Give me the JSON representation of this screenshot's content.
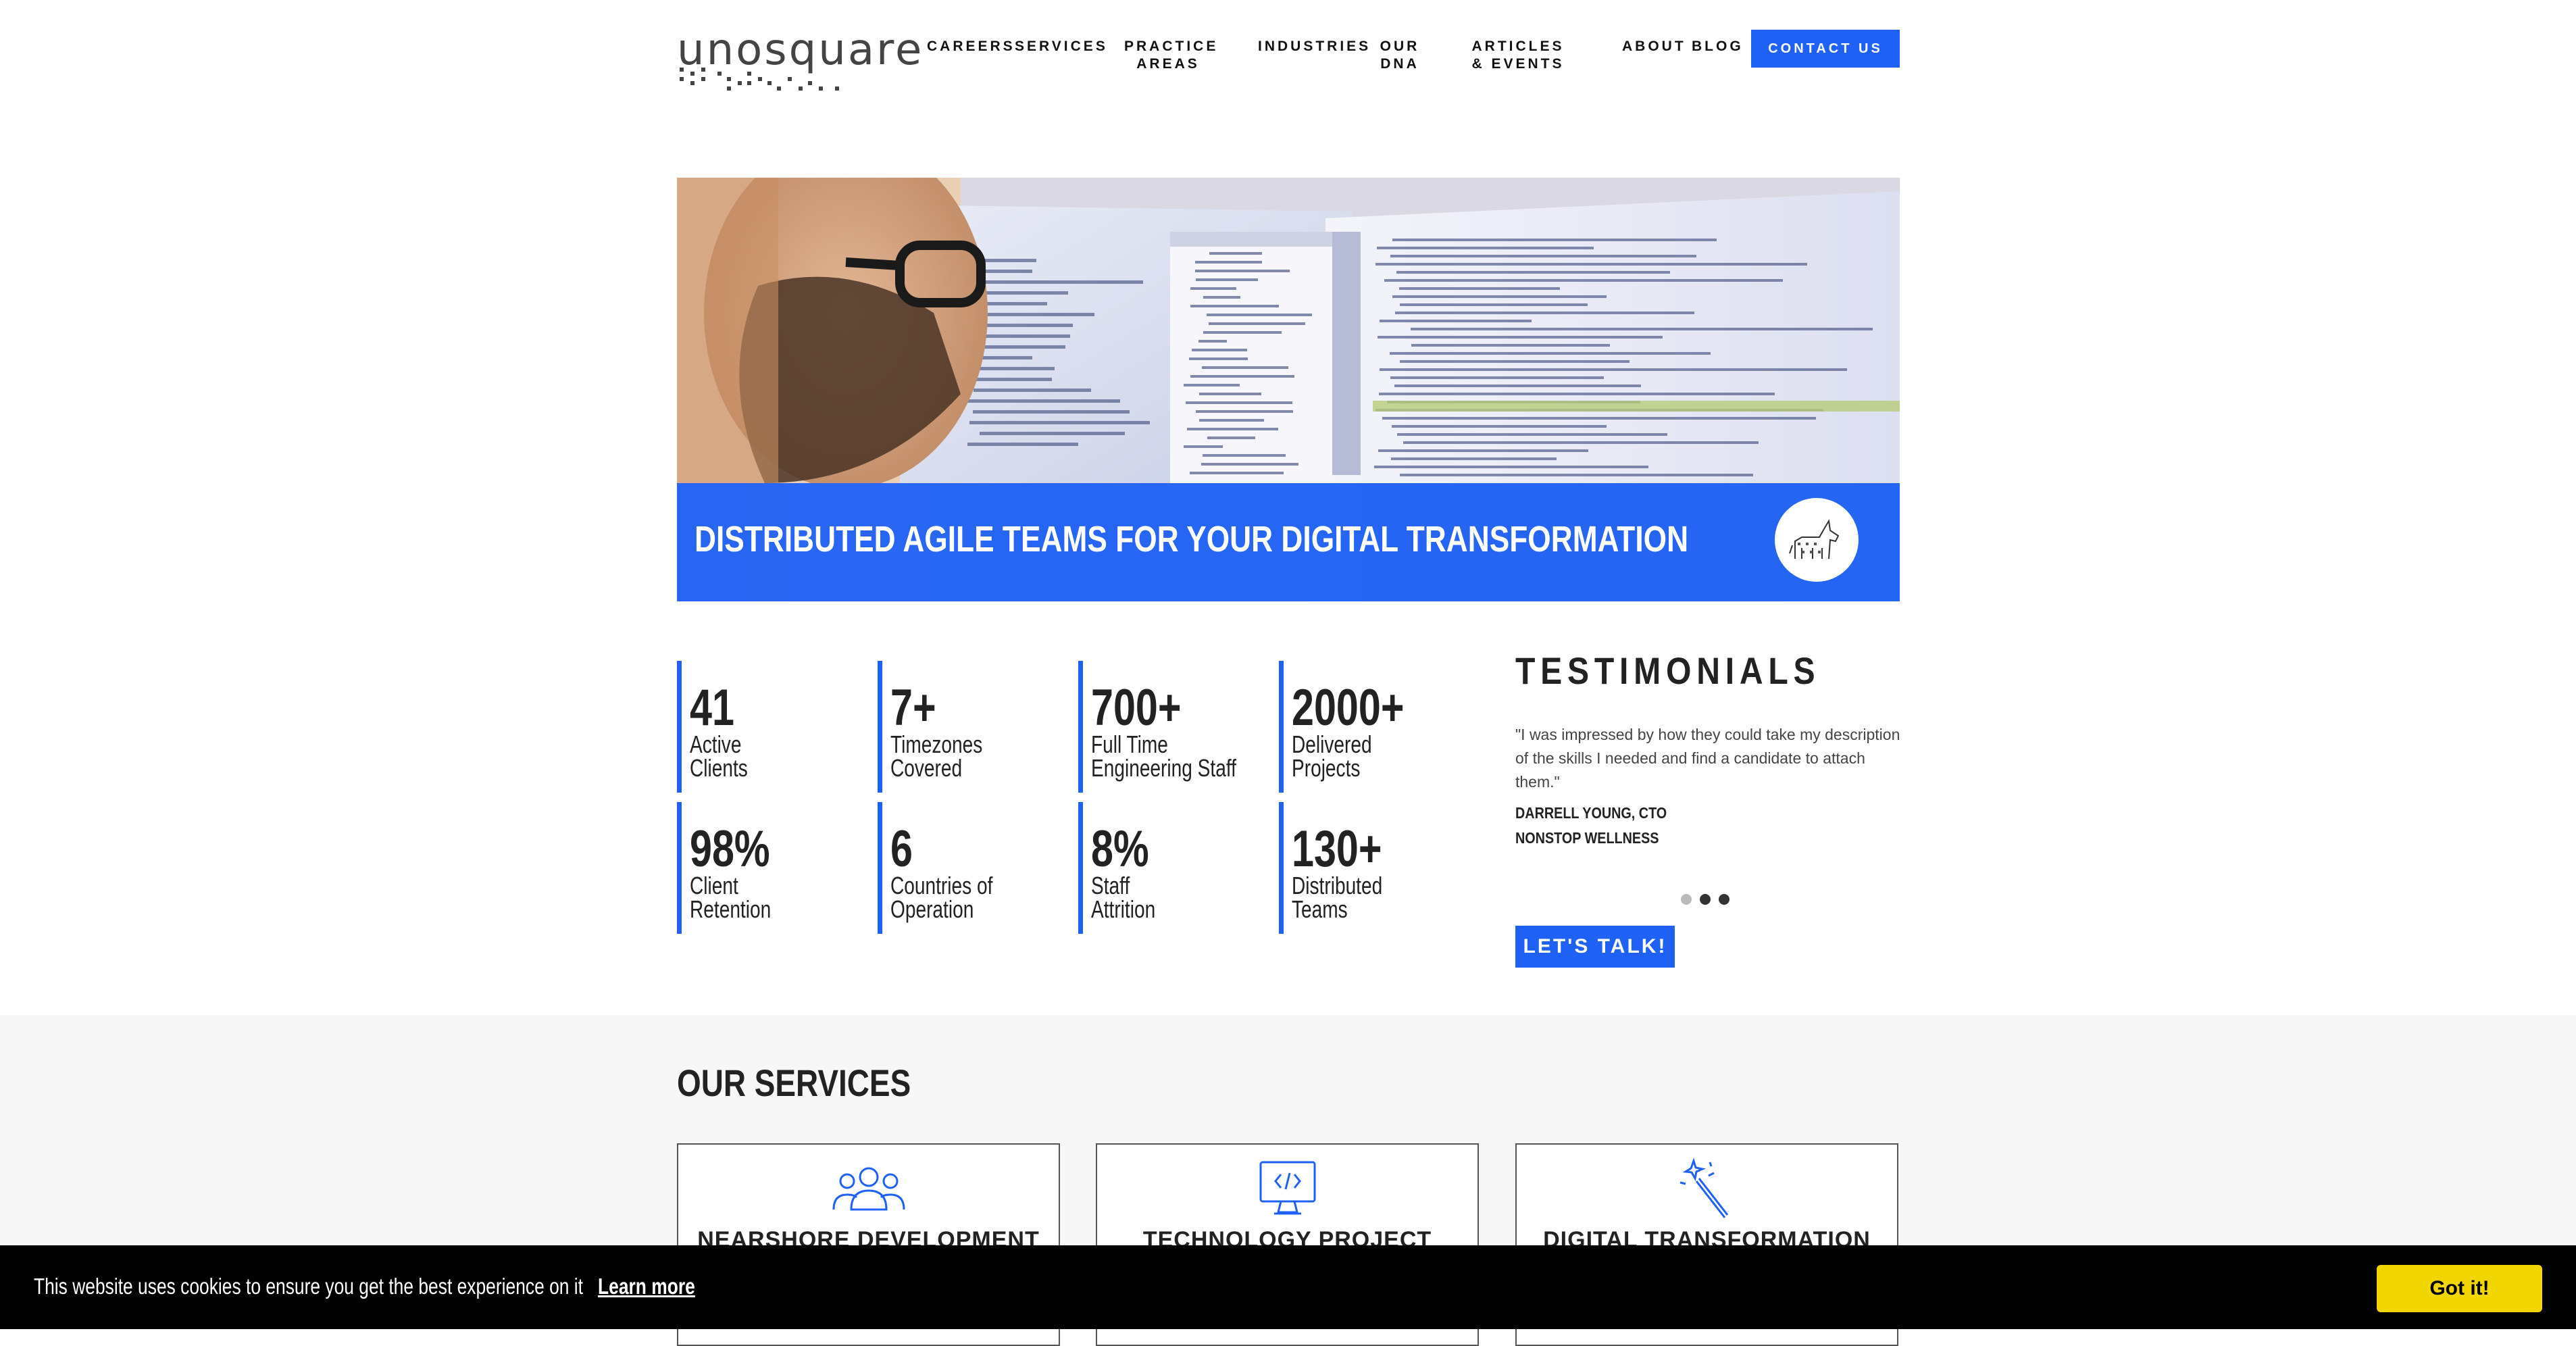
{
  "brand": {
    "logo_text": "unosquare"
  },
  "nav": {
    "items": [
      "CAREERS",
      "SERVICES",
      "PRACTICE AREAS",
      "INDUSTRIES",
      "OUR DNA",
      "ARTICLES & EVENTS",
      "ABOUT",
      "BLOG"
    ],
    "contact_label": "CONTACT US"
  },
  "hero": {
    "title": "DISTRIBUTED AGILE TEAMS FOR YOUR DIGITAL TRANSFORMATION",
    "badge_icon": "unicorn-icon"
  },
  "stats": [
    {
      "value": "41",
      "label": "Active Clients"
    },
    {
      "value": "7+",
      "label": "Timezones Covered"
    },
    {
      "value": "700+",
      "label": "Full Time Engineering Staff"
    },
    {
      "value": "2000+",
      "label": "Delivered Projects"
    },
    {
      "value": "98%",
      "label": "Client Retention"
    },
    {
      "value": "6",
      "label": "Countries of Operation"
    },
    {
      "value": "8%",
      "label": "Staff Attrition"
    },
    {
      "value": "130+",
      "label": "Distributed Teams"
    }
  ],
  "testimonials": {
    "heading": "TESTIMONIALS",
    "quote": "\"I was impressed by how they could take my description of the skills I needed and find a candidate to attach them.\"",
    "author": "DARRELL YOUNG, CTO",
    "company": "NONSTOP WELLNESS",
    "active_dot": 0,
    "cta_label": "LET'S TALK!"
  },
  "services": {
    "title": "OUR SERVICES",
    "cards": [
      {
        "title": "NEARSHORE DEVELOPMENT",
        "icon": "team-icon"
      },
      {
        "title": "TECHNOLOGY PROJECT",
        "icon": "monitor-code-icon"
      },
      {
        "title": "DIGITAL TRANSFORMATION",
        "icon": "magic-wand-icon"
      }
    ]
  },
  "cookie": {
    "message": "This website uses cookies to ensure you get the best experience on it",
    "link_label": "Learn more",
    "button_label": "Got it!"
  },
  "colors": {
    "accent": "#1f61f5",
    "cookie_button": "#f1d600",
    "dot_active": "#bbbbbb",
    "dot_inactive": "#333333"
  }
}
